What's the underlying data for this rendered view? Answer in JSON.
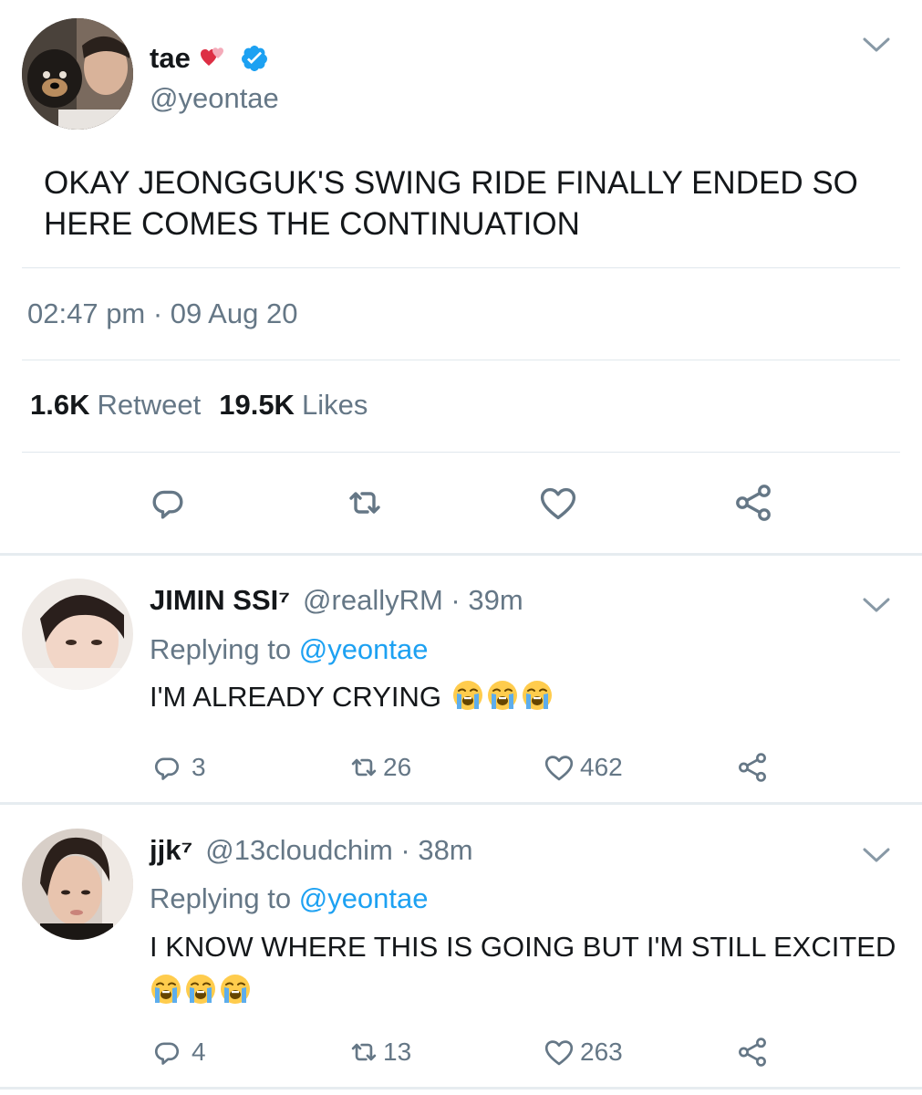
{
  "main_tweet": {
    "display_name": "tae",
    "handle": "@yeontae",
    "text": "OKAY JEONGGUK'S SWING RIDE FINALLY ENDED SO HERE COMES THE CONTINUATION",
    "timestamp": "02:47 pm · 09 Aug 20",
    "retweets_count": "1.6K",
    "retweets_label": "Retweet",
    "likes_count": "19.5K",
    "likes_label": "Likes",
    "icons": [
      "heart-emoji",
      "verified-badge",
      "chevron-down",
      "reply",
      "retweet",
      "like",
      "share"
    ]
  },
  "replies": [
    {
      "display_name": "JIMIN SSI⁷",
      "meta": "@reallyRM · 39m",
      "replying_prefix": "Replying to",
      "replying_to": "@yeontae",
      "text": "I'M ALREADY CRYING",
      "emojis": [
        "loudly-crying-face",
        "loudly-crying-face",
        "loudly-crying-face"
      ],
      "reply_count": "3",
      "retweet_count": "26",
      "like_count": "462"
    },
    {
      "display_name": "jjk⁷",
      "meta": "@13cloudchim · 38m",
      "replying_prefix": "Replying to",
      "replying_to": "@yeontae",
      "text": "I KNOW WHERE THIS IS GOING BUT I'M STILL EXCITED",
      "emojis": [
        "loudly-crying-face",
        "loudly-crying-face",
        "loudly-crying-face"
      ],
      "reply_count": "4",
      "retweet_count": "13",
      "like_count": "263"
    }
  ],
  "colors": {
    "text": "#14171a",
    "secondary": "#657786",
    "link": "#1da1f2",
    "divider": "#e1e8ed"
  }
}
